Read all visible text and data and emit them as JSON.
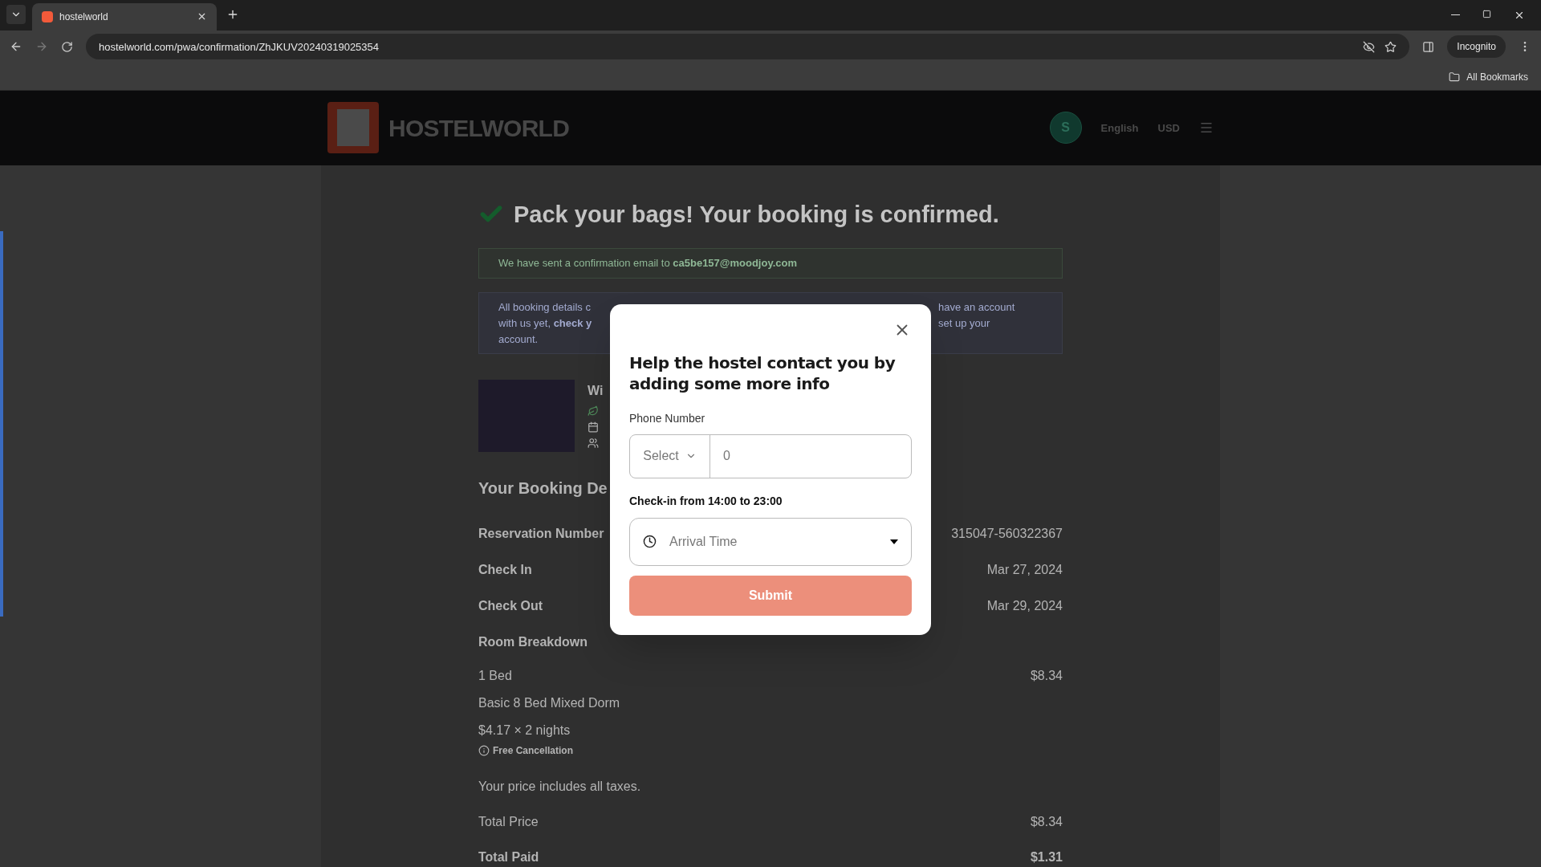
{
  "browser": {
    "tab_title": "hostelworld",
    "url": "hostelworld.com/pwa/confirmation/ZhJKUV20240319025354",
    "incognito_label": "Incognito",
    "bookmarks_label": "All Bookmarks"
  },
  "header": {
    "brand": "HOSTELWORLD",
    "avatar_initial": "S",
    "language": "English",
    "currency": "USD"
  },
  "page": {
    "heading": "Pack your bags! Your booking is confirmed.",
    "email_notice": "We have sent a confirmation email to **ca5be157@moodjoy.com**",
    "info_left": [
      "All booking details c",
      "with us yet, **check y**",
      "account."
    ],
    "info_right": [
      "have an account",
      "set up your"
    ],
    "hostel_name": "Wi",
    "details_title": "Your Booking De",
    "rows": [
      {
        "label": "Reservation Number",
        "value": "315047-560322367"
      },
      {
        "label": "Check In",
        "value": "Mar 27, 2024"
      },
      {
        "label": "Check Out",
        "value": "Mar 29, 2024"
      }
    ],
    "room_title": "Room Breakdown",
    "room_lines": [
      "1 Bed",
      "Basic 8 Bed Mixed Dorm",
      "$4.17 × 2 nights"
    ],
    "room_price": "$8.34",
    "free_cancellation": "Free Cancellation",
    "taxes_note": "Your price includes all taxes.",
    "totals": [
      {
        "label": "Total Price",
        "value": "$8.34",
        "bold": false
      },
      {
        "label": "Total Paid",
        "value": "$1.31",
        "bold": true
      }
    ]
  },
  "modal": {
    "title": "Help the hostel contact you by adding some more info",
    "phone_label": "Phone Number",
    "country_select": "Select",
    "phone_value": "0",
    "checkin_label": "Check-in from 14:00 to 23:00",
    "arrival_placeholder": "Arrival Time",
    "submit": "Submit",
    "submit_disabled": true
  }
}
